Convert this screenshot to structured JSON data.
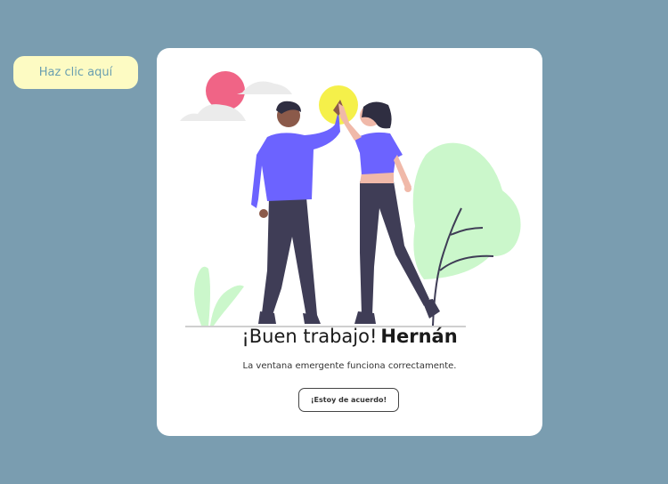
{
  "trigger": {
    "label": "Haz clic aquí"
  },
  "popup": {
    "title_prefix": "¡Buen trabajo!",
    "title_name": "Hernán",
    "message": "La ventana emergente funciona correctamente.",
    "confirm_label": "¡Estoy de acuerdo!"
  },
  "illustration": {
    "icon": "high-five-illustration",
    "colors": {
      "sun": "#f06486",
      "highlight": "#f5f04a",
      "shirt": "#6c63ff",
      "pants": "#3f3d56",
      "plant": "#cbf7cb",
      "cloud": "#ebebeb"
    }
  },
  "colors": {
    "background": "#7a9db0",
    "trigger_bg": "#fdfbc3",
    "trigger_text": "#6a9fb0"
  }
}
